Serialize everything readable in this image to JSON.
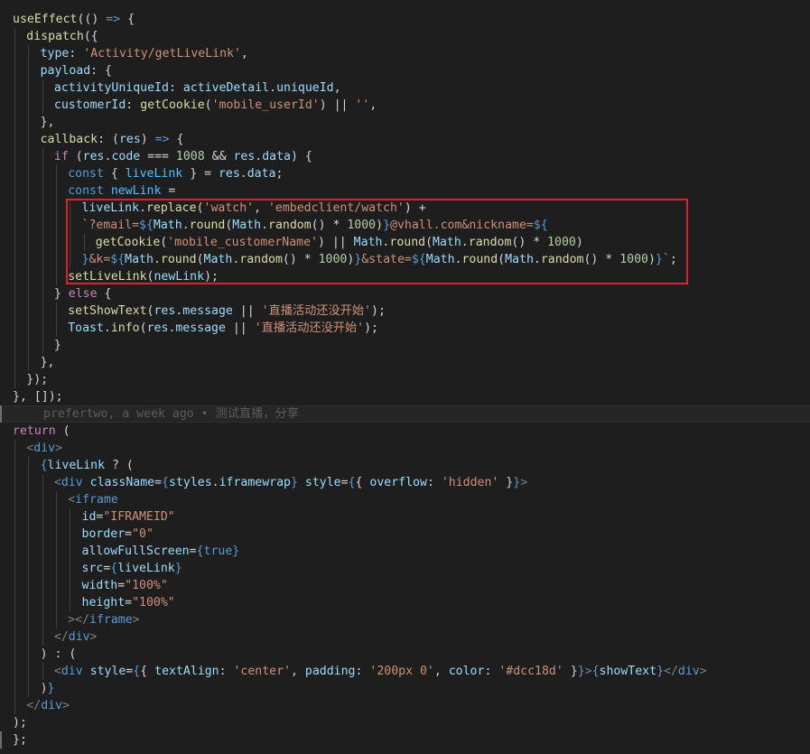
{
  "editor": {
    "theme_colors": {
      "background": "#1e1e1e",
      "keyword": "#569cd6",
      "control": "#c586c0",
      "function": "#dcdcaa",
      "variable": "#9cdcfe",
      "string": "#ce9178",
      "number": "#b5cea8",
      "highlight_box": "#e0202a"
    },
    "blame": {
      "text": "prefertwo, a week ago • 测试直播，分享"
    },
    "lines": [
      {
        "indent": 0,
        "tokens": [
          [
            "fn",
            "useEffect"
          ],
          [
            "punc",
            "(() "
          ],
          [
            "kw",
            "=>"
          ],
          [
            "punc",
            " {"
          ]
        ]
      },
      {
        "indent": 1,
        "tokens": [
          [
            "fn",
            "dispatch"
          ],
          [
            "punc",
            "({"
          ]
        ]
      },
      {
        "indent": 2,
        "tokens": [
          [
            "var",
            "type"
          ],
          [
            "punc",
            ": "
          ],
          [
            "str",
            "'Activity/getLiveLink'"
          ],
          [
            "punc",
            ","
          ]
        ]
      },
      {
        "indent": 2,
        "tokens": [
          [
            "var",
            "payload"
          ],
          [
            "punc",
            ": {"
          ]
        ]
      },
      {
        "indent": 3,
        "tokens": [
          [
            "var",
            "activityUniqueId"
          ],
          [
            "punc",
            ": "
          ],
          [
            "var",
            "activeDetail"
          ],
          [
            "punc",
            "."
          ],
          [
            "var",
            "uniqueId"
          ],
          [
            "punc",
            ","
          ]
        ]
      },
      {
        "indent": 3,
        "tokens": [
          [
            "var",
            "customerId"
          ],
          [
            "punc",
            ": "
          ],
          [
            "fn",
            "getCookie"
          ],
          [
            "punc",
            "("
          ],
          [
            "str",
            "'mobile_userId'"
          ],
          [
            "punc",
            ") || "
          ],
          [
            "str",
            "''"
          ],
          [
            "punc",
            ","
          ]
        ]
      },
      {
        "indent": 2,
        "tokens": [
          [
            "punc",
            "},"
          ]
        ]
      },
      {
        "indent": 2,
        "tokens": [
          [
            "fn",
            "callback"
          ],
          [
            "punc",
            ": ("
          ],
          [
            "var",
            "res"
          ],
          [
            "punc",
            ") "
          ],
          [
            "kw",
            "=>"
          ],
          [
            "punc",
            " {"
          ]
        ]
      },
      {
        "indent": 3,
        "tokens": [
          [
            "ctrl",
            "if"
          ],
          [
            "punc",
            " ("
          ],
          [
            "var",
            "res"
          ],
          [
            "punc",
            "."
          ],
          [
            "var",
            "code"
          ],
          [
            "punc",
            " === "
          ],
          [
            "num",
            "1008"
          ],
          [
            "punc",
            " && "
          ],
          [
            "var",
            "res"
          ],
          [
            "punc",
            "."
          ],
          [
            "var",
            "data"
          ],
          [
            "punc",
            ") {"
          ]
        ]
      },
      {
        "indent": 4,
        "tokens": [
          [
            "kw",
            "const"
          ],
          [
            "punc",
            " { "
          ],
          [
            "const",
            "liveLink"
          ],
          [
            "punc",
            " } = "
          ],
          [
            "var",
            "res"
          ],
          [
            "punc",
            "."
          ],
          [
            "var",
            "data"
          ],
          [
            "punc",
            ";"
          ]
        ]
      },
      {
        "indent": 4,
        "tokens": [
          [
            "kw",
            "const"
          ],
          [
            "punc",
            " "
          ],
          [
            "const",
            "newLink"
          ],
          [
            "punc",
            " ="
          ]
        ]
      },
      {
        "indent": 5,
        "tokens": [
          [
            "var",
            "liveLink"
          ],
          [
            "punc",
            "."
          ],
          [
            "fn",
            "replace"
          ],
          [
            "punc",
            "("
          ],
          [
            "str",
            "'watch'"
          ],
          [
            "punc",
            ", "
          ],
          [
            "str",
            "'embedclient/watch'"
          ],
          [
            "punc",
            ") +"
          ]
        ]
      },
      {
        "indent": 5,
        "tokens": [
          [
            "tpl",
            "`?email="
          ],
          [
            "tplx",
            "${"
          ],
          [
            "var",
            "Math"
          ],
          [
            "punc",
            "."
          ],
          [
            "fn",
            "round"
          ],
          [
            "punc",
            "("
          ],
          [
            "var",
            "Math"
          ],
          [
            "punc",
            "."
          ],
          [
            "fn",
            "random"
          ],
          [
            "punc",
            "() * "
          ],
          [
            "num",
            "1000"
          ],
          [
            "punc",
            ")"
          ],
          [
            "tplx",
            "}"
          ],
          [
            "tpl",
            "@vhall.com&nickname="
          ],
          [
            "tplx",
            "${"
          ]
        ]
      },
      {
        "indent": 6,
        "tokens": [
          [
            "fn",
            "getCookie"
          ],
          [
            "punc",
            "("
          ],
          [
            "str",
            "'mobile_customerName'"
          ],
          [
            "punc",
            ") || "
          ],
          [
            "var",
            "Math"
          ],
          [
            "punc",
            "."
          ],
          [
            "fn",
            "round"
          ],
          [
            "punc",
            "("
          ],
          [
            "var",
            "Math"
          ],
          [
            "punc",
            "."
          ],
          [
            "fn",
            "random"
          ],
          [
            "punc",
            "() * "
          ],
          [
            "num",
            "1000"
          ],
          [
            "punc",
            ")"
          ]
        ]
      },
      {
        "indent": 5,
        "tokens": [
          [
            "tplx",
            "}"
          ],
          [
            "tpl",
            "&k="
          ],
          [
            "tplx",
            "${"
          ],
          [
            "var",
            "Math"
          ],
          [
            "punc",
            "."
          ],
          [
            "fn",
            "round"
          ],
          [
            "punc",
            "("
          ],
          [
            "var",
            "Math"
          ],
          [
            "punc",
            "."
          ],
          [
            "fn",
            "random"
          ],
          [
            "punc",
            "() * "
          ],
          [
            "num",
            "1000"
          ],
          [
            "punc",
            ")"
          ],
          [
            "tplx",
            "}"
          ],
          [
            "tpl",
            "&state="
          ],
          [
            "tplx",
            "${"
          ],
          [
            "var",
            "Math"
          ],
          [
            "punc",
            "."
          ],
          [
            "fn",
            "round"
          ],
          [
            "punc",
            "("
          ],
          [
            "var",
            "Math"
          ],
          [
            "punc",
            "."
          ],
          [
            "fn",
            "random"
          ],
          [
            "punc",
            "() * "
          ],
          [
            "num",
            "1000"
          ],
          [
            "punc",
            ")"
          ],
          [
            "tplx",
            "}"
          ],
          [
            "tpl",
            "`"
          ],
          [
            "punc",
            ";"
          ]
        ]
      },
      {
        "indent": 4,
        "tokens": [
          [
            "fn",
            "setLiveLink"
          ],
          [
            "punc",
            "("
          ],
          [
            "var",
            "newLink"
          ],
          [
            "punc",
            ");"
          ]
        ]
      },
      {
        "indent": 3,
        "tokens": [
          [
            "punc",
            "} "
          ],
          [
            "ctrl",
            "else"
          ],
          [
            "punc",
            " {"
          ]
        ]
      },
      {
        "indent": 4,
        "tokens": [
          [
            "fn",
            "setShowText"
          ],
          [
            "punc",
            "("
          ],
          [
            "var",
            "res"
          ],
          [
            "punc",
            "."
          ],
          [
            "var",
            "message"
          ],
          [
            "punc",
            " || "
          ],
          [
            "str",
            "'直播活动还没开始'"
          ],
          [
            "punc",
            ");"
          ]
        ]
      },
      {
        "indent": 4,
        "tokens": [
          [
            "var",
            "Toast"
          ],
          [
            "punc",
            "."
          ],
          [
            "fn",
            "info"
          ],
          [
            "punc",
            "("
          ],
          [
            "var",
            "res"
          ],
          [
            "punc",
            "."
          ],
          [
            "var",
            "message"
          ],
          [
            "punc",
            " || "
          ],
          [
            "str",
            "'直播活动还没开始'"
          ],
          [
            "punc",
            ");"
          ]
        ]
      },
      {
        "indent": 3,
        "tokens": [
          [
            "punc",
            "}"
          ]
        ]
      },
      {
        "indent": 2,
        "tokens": [
          [
            "punc",
            "},"
          ]
        ]
      },
      {
        "indent": 1,
        "tokens": [
          [
            "punc",
            "});"
          ]
        ]
      },
      {
        "indent": 0,
        "tokens": [
          [
            "punc",
            "}, []);"
          ]
        ]
      },
      {
        "indent": 0,
        "blame": true,
        "tokens": []
      },
      {
        "indent": 0,
        "tokens": [
          [
            "ctrl",
            "return"
          ],
          [
            "punc",
            " ("
          ]
        ]
      },
      {
        "indent": 1,
        "tokens": [
          [
            "gray",
            "<"
          ],
          [
            "tag",
            "div"
          ],
          [
            "gray",
            ">"
          ]
        ]
      },
      {
        "indent": 2,
        "tokens": [
          [
            "tplx",
            "{"
          ],
          [
            "var",
            "liveLink"
          ],
          [
            "punc",
            " ? ("
          ]
        ]
      },
      {
        "indent": 3,
        "tokens": [
          [
            "gray",
            "<"
          ],
          [
            "tag",
            "div"
          ],
          [
            "punc",
            " "
          ],
          [
            "attr",
            "className"
          ],
          [
            "punc",
            "="
          ],
          [
            "tplx",
            "{"
          ],
          [
            "var",
            "styles"
          ],
          [
            "punc",
            "."
          ],
          [
            "var",
            "iframewrap"
          ],
          [
            "tplx",
            "}"
          ],
          [
            "punc",
            " "
          ],
          [
            "attr",
            "style"
          ],
          [
            "punc",
            "="
          ],
          [
            "tplx",
            "{"
          ],
          [
            "punc",
            "{ "
          ],
          [
            "var",
            "overflow"
          ],
          [
            "punc",
            ": "
          ],
          [
            "str",
            "'hidden'"
          ],
          [
            "punc",
            " }"
          ],
          [
            "tplx",
            "}"
          ],
          [
            "gray",
            ">"
          ]
        ]
      },
      {
        "indent": 4,
        "tokens": [
          [
            "gray",
            "<"
          ],
          [
            "tag",
            "iframe"
          ]
        ]
      },
      {
        "indent": 5,
        "tokens": [
          [
            "attr",
            "id"
          ],
          [
            "punc",
            "="
          ],
          [
            "str",
            "\"IFRAMEID\""
          ]
        ]
      },
      {
        "indent": 5,
        "tokens": [
          [
            "attr",
            "border"
          ],
          [
            "punc",
            "="
          ],
          [
            "str",
            "\"0\""
          ]
        ]
      },
      {
        "indent": 5,
        "tokens": [
          [
            "attr",
            "allowFullScreen"
          ],
          [
            "punc",
            "="
          ],
          [
            "tplx",
            "{"
          ],
          [
            "kw",
            "true"
          ],
          [
            "tplx",
            "}"
          ]
        ]
      },
      {
        "indent": 5,
        "tokens": [
          [
            "attr",
            "src"
          ],
          [
            "punc",
            "="
          ],
          [
            "tplx",
            "{"
          ],
          [
            "var",
            "liveLink"
          ],
          [
            "tplx",
            "}"
          ]
        ]
      },
      {
        "indent": 5,
        "tokens": [
          [
            "attr",
            "width"
          ],
          [
            "punc",
            "="
          ],
          [
            "str",
            "\"100%\""
          ]
        ]
      },
      {
        "indent": 5,
        "tokens": [
          [
            "attr",
            "height"
          ],
          [
            "punc",
            "="
          ],
          [
            "str",
            "\"100%\""
          ]
        ]
      },
      {
        "indent": 4,
        "tokens": [
          [
            "gray",
            "></"
          ],
          [
            "tag",
            "iframe"
          ],
          [
            "gray",
            ">"
          ]
        ]
      },
      {
        "indent": 3,
        "tokens": [
          [
            "gray",
            "</"
          ],
          [
            "tag",
            "div"
          ],
          [
            "gray",
            ">"
          ]
        ]
      },
      {
        "indent": 2,
        "tokens": [
          [
            "punc",
            ") : ("
          ]
        ]
      },
      {
        "indent": 3,
        "tokens": [
          [
            "gray",
            "<"
          ],
          [
            "tag",
            "div"
          ],
          [
            "punc",
            " "
          ],
          [
            "attr",
            "style"
          ],
          [
            "punc",
            "="
          ],
          [
            "tplx",
            "{"
          ],
          [
            "punc",
            "{ "
          ],
          [
            "var",
            "textAlign"
          ],
          [
            "punc",
            ": "
          ],
          [
            "str",
            "'center'"
          ],
          [
            "punc",
            ", "
          ],
          [
            "var",
            "padding"
          ],
          [
            "punc",
            ": "
          ],
          [
            "str",
            "'200px 0'"
          ],
          [
            "punc",
            ", "
          ],
          [
            "var",
            "color"
          ],
          [
            "punc",
            ": "
          ],
          [
            "str",
            "'#dcc18d'"
          ],
          [
            "punc",
            " }"
          ],
          [
            "tplx",
            "}"
          ],
          [
            "gray",
            ">"
          ],
          [
            "tplx",
            "{"
          ],
          [
            "var",
            "showText"
          ],
          [
            "tplx",
            "}"
          ],
          [
            "gray",
            "</"
          ],
          [
            "tag",
            "div"
          ],
          [
            "gray",
            ">"
          ]
        ]
      },
      {
        "indent": 2,
        "tokens": [
          [
            "punc",
            ")"
          ],
          [
            "tplx",
            "}"
          ]
        ]
      },
      {
        "indent": 1,
        "tokens": [
          [
            "gray",
            "</"
          ],
          [
            "tag",
            "div"
          ],
          [
            "gray",
            ">"
          ]
        ]
      },
      {
        "indent": 0,
        "tokens": [
          [
            "punc",
            ");"
          ]
        ]
      },
      {
        "indent": 0,
        "tokens": [
          [
            "punc",
            "};"
          ]
        ]
      }
    ]
  }
}
